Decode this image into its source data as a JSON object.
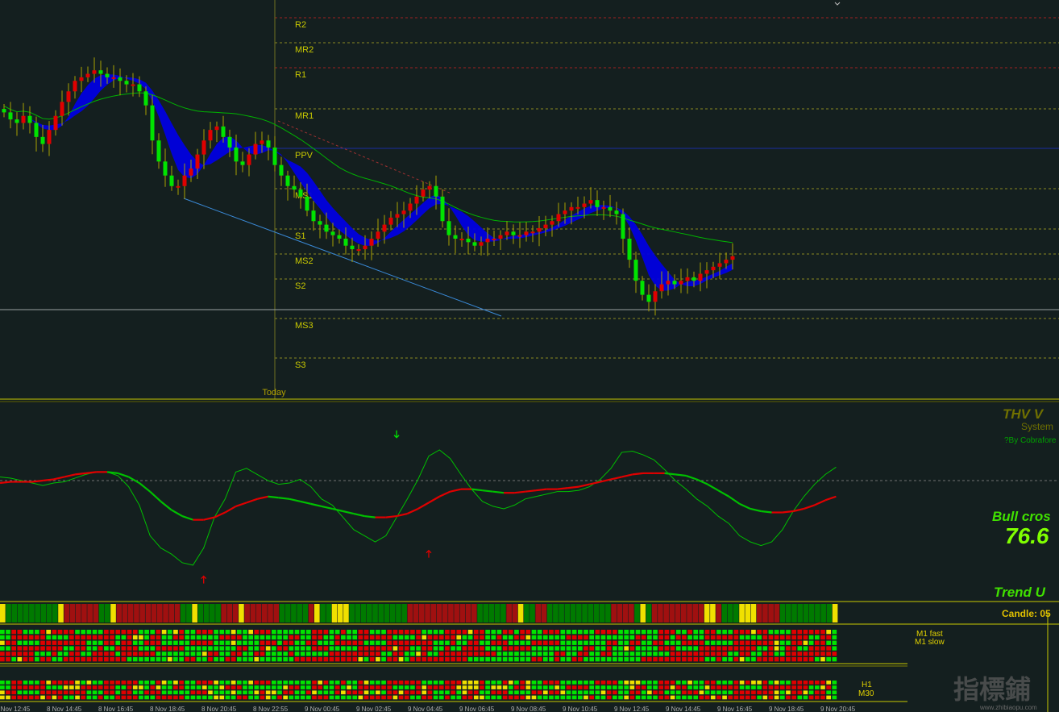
{
  "colors": {
    "background": "#141f1f",
    "bull": "#00e400",
    "bear": "#e00000",
    "wick": "#a8a000",
    "cloud": "#0000e0",
    "ma_slow": "#00b400",
    "ma_fast": "#c00000",
    "oscillator_fast": "#00c000",
    "oscillator_slow": "#e00000",
    "separator": "#c8c800",
    "pivot_line": "#8a8a20",
    "resistance_line": "#a02020",
    "pivot_label": "#c8c800",
    "thv_title": "#707000",
    "signal_text": "#40e000",
    "value_text": "#80ff00",
    "strip_green": "#007a00",
    "strip_red": "#a01010",
    "strip_yellow": "#f0e000"
  },
  "chart_data": [
    {
      "type": "candlestick",
      "panel": "price",
      "levels": [
        {
          "label": "R2",
          "kind": "resistance"
        },
        {
          "label": "MR2",
          "kind": "mid"
        },
        {
          "label": "R1",
          "kind": "resistance"
        },
        {
          "label": "MR1",
          "kind": "mid"
        },
        {
          "label": "PPV",
          "kind": "pivot"
        },
        {
          "label": "MS1",
          "kind": "mid"
        },
        {
          "label": "S1",
          "kind": "support"
        },
        {
          "label": "MS2",
          "kind": "mid"
        },
        {
          "label": "S2",
          "kind": "support"
        },
        {
          "label": "MS3",
          "kind": "mid"
        },
        {
          "label": "S3",
          "kind": "support"
        }
      ],
      "ylim": [
        0,
        100
      ],
      "session_marker": "Today",
      "close": [
        76,
        74,
        73,
        75,
        73,
        69,
        67,
        71,
        75,
        79,
        82,
        85,
        86,
        87,
        88,
        87,
        86,
        86,
        85,
        84,
        84,
        82,
        78,
        68,
        62,
        58,
        55,
        55,
        58,
        60,
        64,
        68,
        71,
        72,
        69,
        66,
        62,
        61,
        64,
        67,
        68,
        66,
        61,
        58,
        55,
        54,
        52,
        48,
        45,
        44,
        42,
        41,
        40,
        38,
        37,
        37,
        38,
        40,
        42,
        44,
        46,
        47,
        48,
        50,
        52,
        54,
        55,
        52,
        45,
        41,
        40,
        40,
        39,
        38,
        39,
        40,
        40,
        41,
        42,
        41,
        41,
        42,
        42,
        43,
        44,
        45,
        47,
        48,
        49,
        49,
        50,
        51,
        49,
        49,
        48,
        47,
        40,
        34,
        28,
        24,
        22,
        25,
        27,
        28,
        27,
        28,
        29,
        28,
        30,
        31,
        32,
        33,
        34,
        35
      ],
      "x_ticks": [
        "8 Nov 12:45",
        "8 Nov 14:45",
        "8 Nov 16:45",
        "8 Nov 18:45",
        "8 Nov 20:45",
        "8 Nov 22:55",
        "9 Nov 00:45",
        "9 Nov 02:45",
        "9 Nov 04:45",
        "9 Nov 06:45",
        "9 Nov 08:45",
        "9 Nov 10:45",
        "9 Nov 12:45",
        "9 Nov 14:45",
        "9 Nov 16:45",
        "9 Nov 18:45",
        "9 Nov 20:45"
      ]
    },
    {
      "type": "line",
      "panel": "oscillator",
      "ylim": [
        0,
        100
      ],
      "series": [
        {
          "key": "fast",
          "values": [
            78,
            77,
            75,
            73,
            71,
            73,
            74,
            77,
            80,
            82,
            82,
            79,
            70,
            55,
            30,
            20,
            15,
            8,
            6,
            20,
            45,
            60,
            82,
            85,
            80,
            75,
            72,
            73,
            76,
            70,
            60,
            55,
            45,
            35,
            30,
            25,
            30,
            45,
            60,
            76,
            95,
            100,
            93,
            80,
            68,
            58,
            54,
            52,
            55,
            60,
            62,
            64,
            66,
            66,
            67,
            70,
            76,
            85,
            98,
            99,
            96,
            92,
            84,
            75,
            68,
            60,
            54,
            46,
            40,
            30,
            25,
            22,
            25,
            35,
            50,
            62,
            72,
            80,
            86
          ]
        },
        {
          "key": "slow",
          "values": [
            73,
            74,
            74,
            74,
            75,
            76,
            78,
            80,
            81,
            82,
            82,
            81,
            78,
            73,
            66,
            58,
            51,
            46,
            43,
            43,
            45,
            49,
            54,
            57,
            60,
            62,
            61,
            60,
            58,
            56,
            54,
            52,
            50,
            48,
            46,
            45,
            45,
            46,
            48,
            52,
            57,
            62,
            66,
            68,
            68,
            67,
            66,
            65,
            65,
            66,
            67,
            68,
            68,
            69,
            70,
            72,
            74,
            76,
            78,
            80,
            81,
            81,
            81,
            80,
            79,
            76,
            72,
            67,
            62,
            56,
            52,
            50,
            49,
            49,
            50,
            52,
            55,
            59,
            62
          ]
        }
      ],
      "ref_line": 75,
      "arrows": [
        {
          "dir": "down",
          "at": 37,
          "level": 112
        },
        {
          "dir": "up",
          "at": 19,
          "level": -5
        },
        {
          "dir": "up",
          "at": 40,
          "level": 16
        }
      ]
    }
  ],
  "thv": {
    "title": "THV V",
    "subtitle": "System",
    "credit": "?By Cobrafore",
    "signal": "Bull cros",
    "value": "76.6",
    "trend": "Trend U",
    "candle": "Candle:  05"
  },
  "today_label": "Today",
  "timeframes": {
    "m1_fast": "M1 fast",
    "m1_slow": "M1 slow",
    "h1": "H1",
    "m30": "M30"
  },
  "strip_pattern": "YGGGGGGGGGYRRRRRRGGYRRRRRRRRRRRGGYGGGGRRRYRRRRRRGGGGGRYGGYYYGGGGGGGGGGRRRRRRRRRRRRGGGGGRRYGGRRGGGGGGGGGGGRRRRGYGRRRRRRRRRYYRGGGYYYRRRRGGGGGGGGGY",
  "watermark": {
    "text": "指標鋪",
    "site": "www.zhibiaopu.com"
  }
}
